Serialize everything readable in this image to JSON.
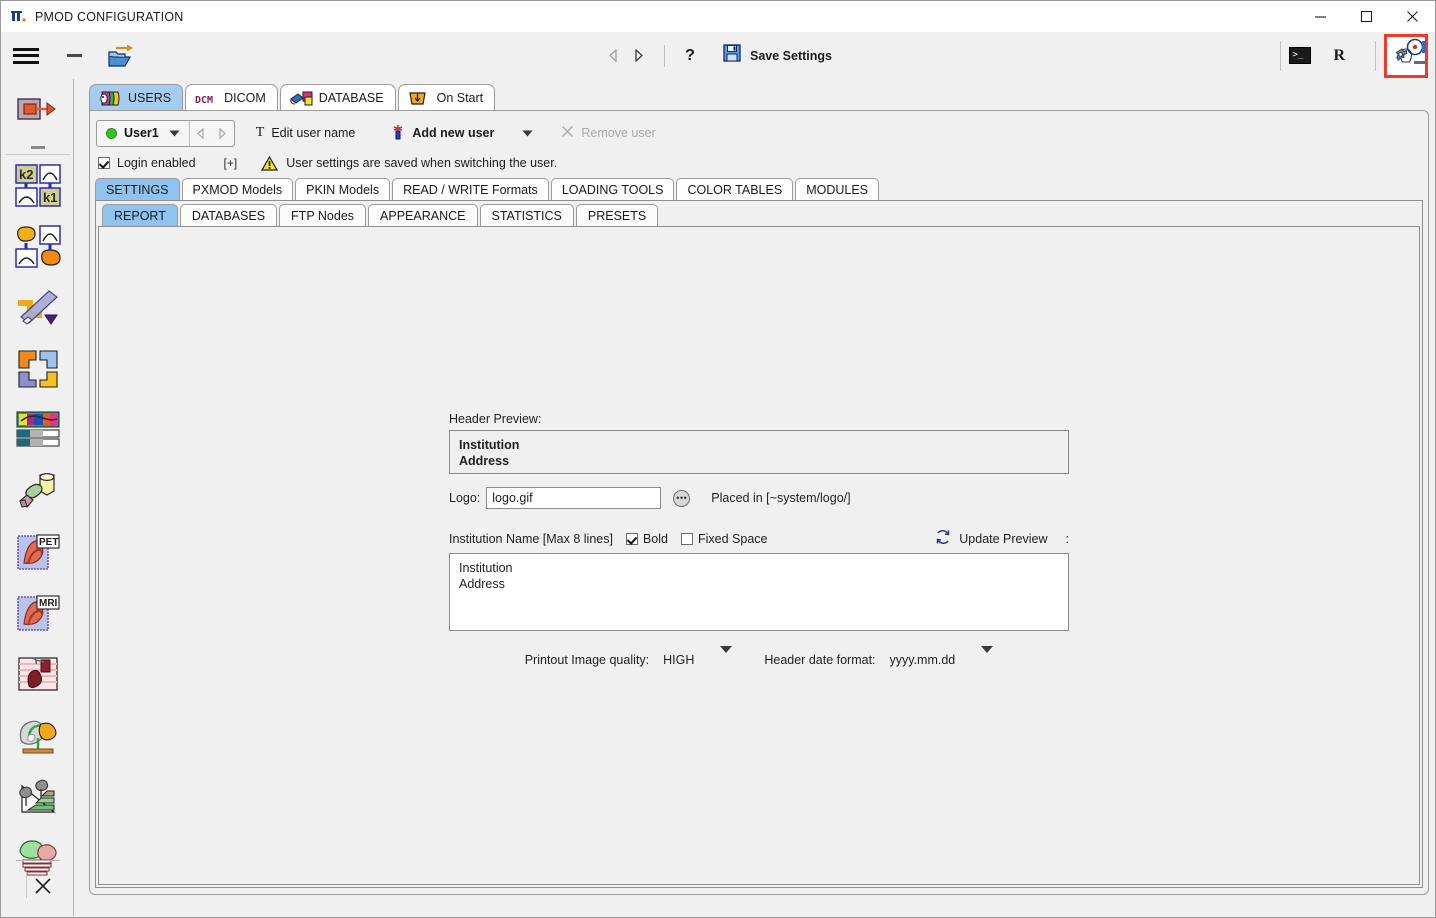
{
  "window": {
    "title": "PMOD CONFIGURATION",
    "app_icon": "pmod-logo-icon",
    "controls": {
      "minimize": "minimize-icon",
      "maximize": "maximize-icon",
      "close": "close-icon"
    }
  },
  "toolbar": {
    "menu_icon": "hamburger-menu-icon",
    "dash_icon": "collapse-dash-icon",
    "open_icon": "open-folder-arrow-icon",
    "prev_icon": "previous-arrow-icon",
    "next_icon": "next-arrow-icon",
    "help_label": "?",
    "save_icon": "floppy-disk-icon",
    "save_label": "Save Settings",
    "terminal_icon": "terminal-icon",
    "terminal_prompt": ">_",
    "r_label": "R",
    "highlighted_icon": "user-configuration-icon",
    "edge_icon": "display-settings-icon",
    "edge_dash_icon": "collapse-dash-icon"
  },
  "rail": {
    "items": [
      {
        "name": "rail-item-data-transfer",
        "icon": "data-transfer-icon"
      },
      {
        "name": "rail-item-kinetic-modeling",
        "icon": "k2-k1-kinetic-icon"
      },
      {
        "name": "rail-item-pkin-modeling",
        "icon": "blob-curve-modeling-icon"
      },
      {
        "name": "rail-item-fusion",
        "icon": "fusion-arrow-icon"
      },
      {
        "name": "rail-item-view",
        "icon": "four-color-panels-icon"
      },
      {
        "name": "rail-item-color-tables",
        "icon": "color-table-bars-icon"
      },
      {
        "name": "rail-item-segmentation",
        "icon": "geometry-shapes-icon"
      },
      {
        "name": "rail-item-pet-cardiac",
        "icon": "pet-heart-icon",
        "badge": "PET"
      },
      {
        "name": "rail-item-mri-cardiac",
        "icon": "mri-heart-icon",
        "badge": "MRI"
      },
      {
        "name": "rail-item-cardiac-perfusion",
        "icon": "heart-perfusion-icon"
      },
      {
        "name": "rail-item-neuro",
        "icon": "brain-head-icon"
      },
      {
        "name": "rail-item-lung",
        "icon": "lung-chart-icon"
      },
      {
        "name": "rail-item-organ-dosimetry",
        "icon": "organ-stack-icon"
      }
    ],
    "close_icon": "close-x-icon"
  },
  "tabs_main": [
    {
      "label": "USERS",
      "icon": "users-cards-icon",
      "active": true
    },
    {
      "label": "DICOM",
      "icon": "dcm-text-icon",
      "active": false
    },
    {
      "label": "DATABASE",
      "icon": "database-boxes-icon",
      "active": false
    },
    {
      "label": "On Start",
      "icon": "on-start-crown-icon",
      "active": false
    }
  ],
  "user_row": {
    "status_dot_color": "#36c325",
    "user_name": "User1",
    "combo_arrow_icon": "chevron-down-icon",
    "prev_icon": "previous-arrow-icon",
    "next_icon": "next-arrow-icon",
    "edit_icon": "text-cursor-icon",
    "edit_label": "Edit user name",
    "add_icon": "add-user-sparkle-icon",
    "add_label": "Add new user",
    "add_dropdown_icon": "chevron-down-icon",
    "remove_icon": "remove-x-icon",
    "remove_label": "Remove user"
  },
  "login_row": {
    "checkbox_checked": true,
    "label": "Login enabled",
    "expand_label": "[+]",
    "warn_icon": "warning-triangle-icon",
    "message": "User settings are saved when switching the user."
  },
  "tabs_settings": [
    {
      "label": "SETTINGS",
      "active": true
    },
    {
      "label": "PXMOD Models",
      "active": false
    },
    {
      "label": "PKIN Models",
      "active": false
    },
    {
      "label": "READ / WRITE Formats",
      "active": false
    },
    {
      "label": "LOADING TOOLS",
      "active": false
    },
    {
      "label": "COLOR TABLES",
      "active": false
    },
    {
      "label": "MODULES",
      "active": false
    }
  ],
  "tabs_report": [
    {
      "label": "REPORT",
      "active": true
    },
    {
      "label": "DATABASES",
      "active": false
    },
    {
      "label": "FTP Nodes",
      "active": false
    },
    {
      "label": "APPEARANCE",
      "active": false
    },
    {
      "label": "STATISTICS",
      "active": false
    },
    {
      "label": "PRESETS",
      "active": false
    }
  ],
  "form": {
    "header_preview_label": "Header Preview:",
    "header_preview_line1": "Institution",
    "header_preview_line2": "Address",
    "logo_label": "Logo:",
    "logo_value": "logo.gif",
    "logo_placeholder": "logo.gif",
    "browse_icon": "ellipsis-button-icon",
    "logo_hint": "Placed in [~system/logo/]",
    "institution_label": "Institution Name [Max 8 lines]",
    "bold_label": "Bold",
    "bold_checked": true,
    "fixed_space_label": "Fixed Space",
    "fixed_space_checked": false,
    "update_icon": "refresh-circular-arrows-icon",
    "update_label": "Update Preview",
    "update_colon": ":",
    "institution_text_line1": "Institution",
    "institution_text_line2": "Address",
    "quality_label": "Printout Image quality:",
    "quality_value": "HIGH",
    "quality_arrow_icon": "chevron-down-icon",
    "date_format_label": "Header date format:",
    "date_format_value": "yyyy.mm.dd",
    "date_format_arrow_icon": "chevron-down-icon"
  },
  "colors": {
    "accent_tab": "#a6cdef",
    "accent_subtab": "#90c3ee",
    "highlight_border": "#f0392b",
    "status_green": "#36c325",
    "panel_bg": "#f0f0f0"
  }
}
